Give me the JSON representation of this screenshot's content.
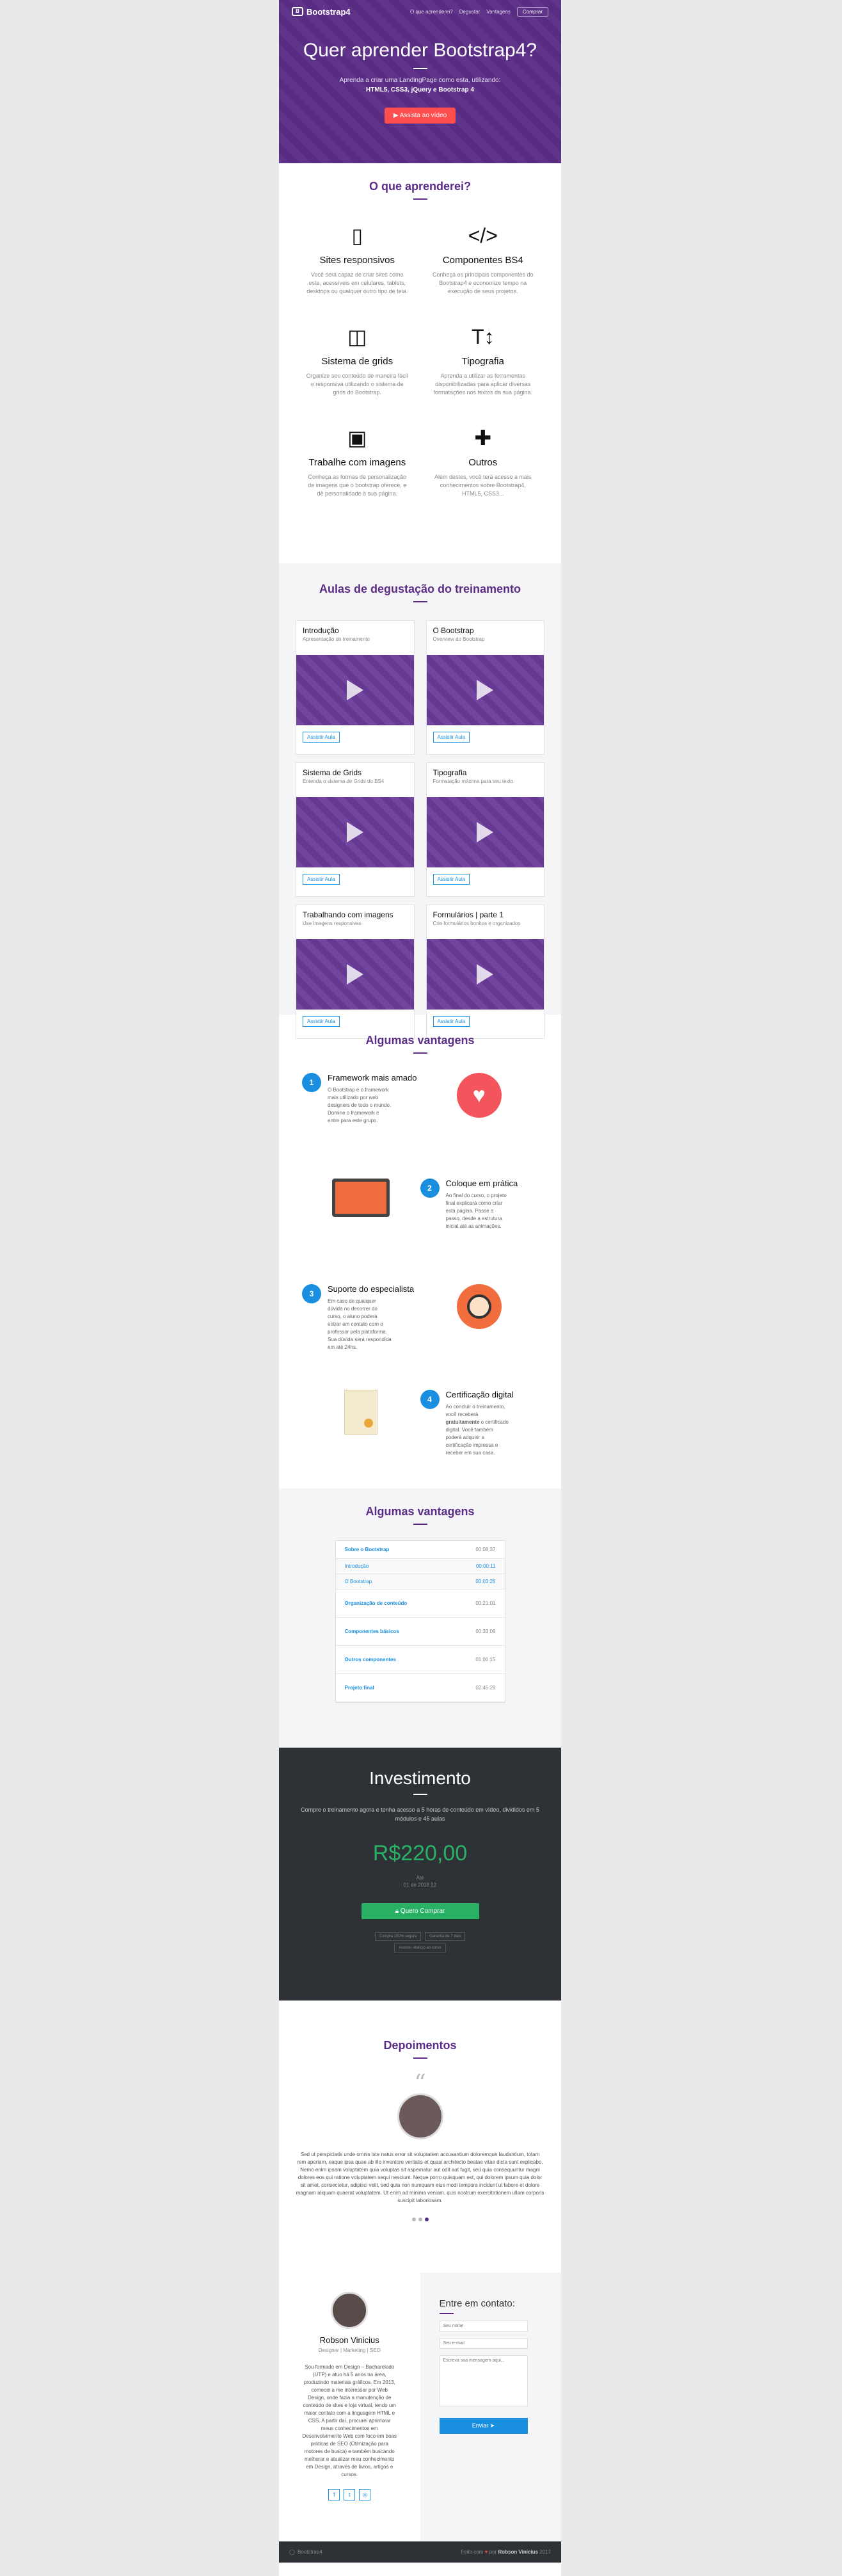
{
  "nav": {
    "brand": "Bootstrap4",
    "links": [
      "O que aprenderei?",
      "Degustar",
      "Vantagens"
    ],
    "button": "Comprar"
  },
  "hero": {
    "title": "Quer aprender Bootstrap4?",
    "subtitle": "Aprenda a criar uma LandingPage como esta, utilizando:",
    "tech": "HTML5, CSS3, jQuery e Bootstrap 4",
    "cta": "Assista ao vídeo"
  },
  "learn": {
    "title": "O que aprenderei?",
    "items": [
      {
        "icon": "mobile-icon",
        "glyph": "▯",
        "title": "Sites responsivos",
        "text": "Você será capaz de criar sites como este, acessíveis em celulares, tablets, desktops ou qualquer outro tipo de tela."
      },
      {
        "icon": "code-icon",
        "glyph": "</>",
        "title": "Componentes BS4",
        "text": "Conheça os principais componentes do Bootstrap4 e economize tempo na execução de seus projetos."
      },
      {
        "icon": "columns-icon",
        "glyph": "◫",
        "title": "Sistema de grids",
        "text": "Organize seu conteúdo de maneira fácil e responsiva utilizando o sistema de grids do Bootstrap."
      },
      {
        "icon": "text-height-icon",
        "glyph": "T↕",
        "title": "Tipografia",
        "text": "Aprenda a utilizar as ferramentas disponibilizadas para aplicar diversas formatações nos textos da sua página."
      },
      {
        "icon": "image-icon",
        "glyph": "▣",
        "title": "Trabalhe com imagens",
        "text": "Conheça as formas de personalização de imagens que o bootstrap oferece, e dê personalidade à sua página."
      },
      {
        "icon": "plus-icon",
        "glyph": "✚",
        "title": "Outros",
        "text": "Além destes, você terá acesso a mais conhecimentos sobre Bootstrap4, HTML5, CSS3..."
      }
    ]
  },
  "courses": {
    "title": "Aulas de degustação do treinamento",
    "button": "Assistir Aula",
    "items": [
      {
        "title": "Introdução",
        "subtitle": "Apresentação do treinamento"
      },
      {
        "title": "O Bootstrap",
        "subtitle": "Overview do Bootstrap"
      },
      {
        "title": "Sistema de Grids",
        "subtitle": "Entenda o sistema de Grids do BS4"
      },
      {
        "title": "Tipografia",
        "subtitle": "Formatação máxima para seu texto"
      },
      {
        "title": "Trabalhando com imagens",
        "subtitle": "Use imagens responsivas"
      },
      {
        "title": "Formulários | parte 1",
        "subtitle": "Crie formulários bonitos e organizados"
      }
    ]
  },
  "advantages": {
    "title": "Algumas vantagens",
    "items": [
      {
        "num": "1",
        "title": "Framework mais amado",
        "text": "O Bootstrap é o framework mais utilizado por web designers de todo o mundo. Domine o framework e entre para este grupo."
      },
      {
        "num": "2",
        "title": "Coloque em prática",
        "text": "Ao final do curso, o projeto final explicará como criar esta página. Passe a passo, desde a estrutura inicial até as animações."
      },
      {
        "num": "3",
        "title": "Suporte do especialista",
        "text": "Em caso de qualquer dúvida no decorrer do curso, o aluno poderá entrar em contato com o professor pela plataforma. Sua dúvida será respondida em até 24hs."
      },
      {
        "num": "4",
        "title": "Certificação digital",
        "text_pre": "Ao concluir o treinamento, você receberá ",
        "text_bold": "gratuitamente",
        "text_post": " o certificado digital. Você também poderá adquirir a certificação impressa e receber em sua casa."
      }
    ]
  },
  "syllabus": {
    "title": "Algumas vantagens",
    "rows": [
      {
        "title": "Sobre o Bootstrap",
        "duration": "00:08:37"
      },
      {
        "title": "Introdução",
        "duration": "00:00:11",
        "sub": true
      },
      {
        "title": "O Bootstrap",
        "duration": "00:03:26",
        "sub": true
      },
      {
        "title": "Organização de conteúdo",
        "duration": "00:21:01"
      },
      {
        "title": "Componentes básicos",
        "duration": "00:33:09"
      },
      {
        "title": "Outros componentes",
        "duration": "01:00:15"
      },
      {
        "title": "Projeto final",
        "duration": "02:45:29"
      }
    ]
  },
  "pricing": {
    "title": "Investimento",
    "description": "Compre o treinamento agora e tenha acesso a 5 horas de conteúdo em vídeo, divididos em 5 módulos e 45 aulas",
    "amount": "R$220,00",
    "until_label": "Até",
    "until_date": "01 de 2018 22",
    "button": "Quero Comprar",
    "badges": [
      "Compra 100% segura",
      "Garantia de 7 dias",
      "Acesso vitalício ao curso"
    ]
  },
  "testimonials": {
    "title": "Depoimentos",
    "quote": "Sed ut perspiciatis unde omnis iste natus error sit voluptatem accusantium doloremque laudantium, totam rem aperiam, eaque ipsa quae ab illo inventore veritatis et quasi architecto beatae vitae dicta sunt explicabo. Nemo enim ipsam voluptatem quia voluptas sit aspernatur aut odit aut fugit, sed quia consequuntur magni dolores eos qui ratione voluptatem sequi nesciunt. Neque porro quisquam est, qui dolorem ipsum quia dolor sit amet, consectetur, adipisci velit, sed quia non numquam eius modi tempora incidunt ut labore et dolore magnam aliquam quaerat voluptatem. Ut enim ad minima veniam, quis nostrum exercitationem ullam corporis suscipit laboriosam."
  },
  "contact": {
    "name": "Robson Vinicius",
    "role": "Designer | Marketing | SEO",
    "bio": "Sou formado em Design – Bacharelado (UTP) e atuo há 5 anos na área, produzindo materiais gráficos. Em 2013, comecei a me interessar por Web Design, onde fazia a manutenção de conteúdo de sites e loja virtual, tendo um maior contato com a linguagem HTML e CSS. A partir daí, procurei aprimorar meus conhecimentos em Desenvolvimento Web com foco em boas práticas de SEO (Otimização para motores de busca) e também buscando melhorar e atualizar meu conhecimento em Design, através de livros, artigos e cursos.",
    "social": [
      "f",
      "t",
      "◎"
    ],
    "form_title": "Entre em contato:",
    "name_placeholder": "Seu nome",
    "email_placeholder": "Seu e-mail",
    "message_placeholder": "Escreva sua mensagem aqui...",
    "send": "Enviar"
  },
  "footer": {
    "logo": "Bootstrap4",
    "credit_pre": "Feito com",
    "credit_mid": "por",
    "credit_name": "Robson Vinicius",
    "year": "2017"
  }
}
